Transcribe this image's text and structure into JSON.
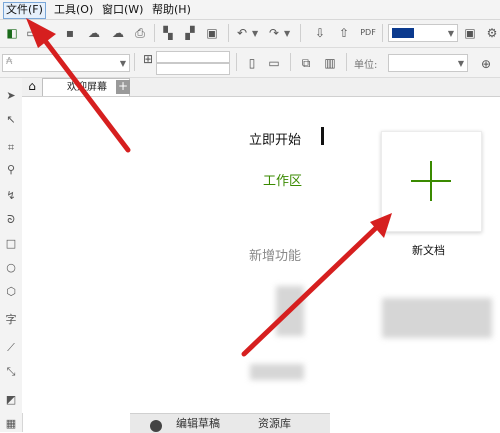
{
  "menubar": {
    "items": [
      "文件(F)",
      "工具(O)",
      "窗口(W)",
      "帮助(H)"
    ]
  },
  "tabs": {
    "welcome_label": "欢迎屏幕",
    "add_label": "+"
  },
  "toolbar": {
    "unit_label": "单位:"
  },
  "welcome": {
    "nav_start": "立即开始",
    "nav_workspace": "工作区",
    "nav_new_features": "新增功能",
    "new_doc_label": "新文档"
  },
  "bottom": {
    "left_text": "编辑草稿",
    "right_text": "资源库"
  },
  "colors": {
    "accent_green": "#3a8a00",
    "arrow_red": "#d61f1f",
    "color_swatch": "#0b3a8e"
  }
}
